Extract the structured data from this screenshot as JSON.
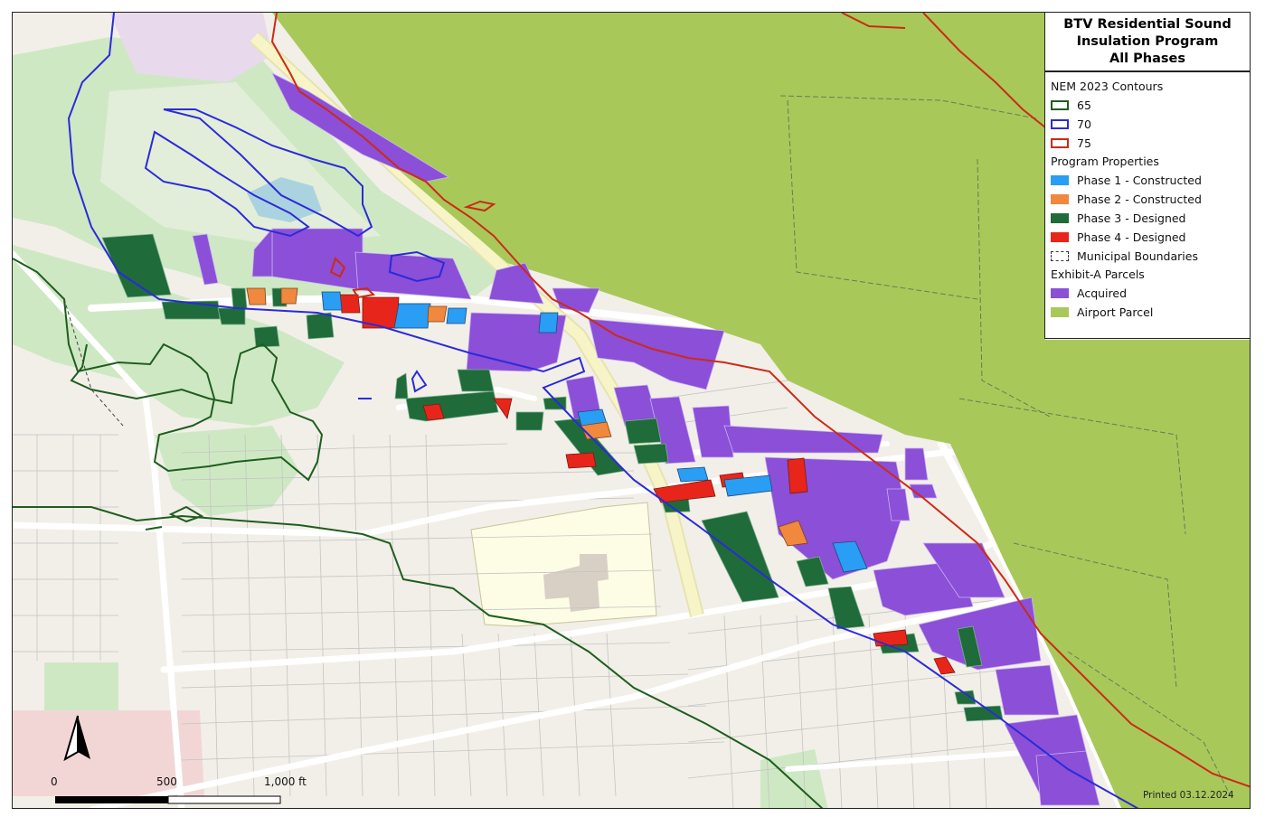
{
  "title": {
    "line1": "BTV Residential Sound",
    "line2": "Insulation Program",
    "line3": "All Phases"
  },
  "legend": {
    "contours_heading": "NEM 2023 Contours",
    "contours": [
      {
        "label": "65",
        "color": "#1e5e1e"
      },
      {
        "label": "70",
        "color": "#2b2bd9"
      },
      {
        "label": "75",
        "color": "#cc2a16"
      }
    ],
    "program_heading": "Program Properties",
    "program": [
      {
        "label": "Phase 1 - Constructed",
        "color": "#2a9df4"
      },
      {
        "label": "Phase 2 - Constructed",
        "color": "#f0883e"
      },
      {
        "label": "Phase 3 - Designed",
        "color": "#1f6b3a"
      },
      {
        "label": "Phase 4 - Designed",
        "color": "#e8251a"
      },
      {
        "label": "Municipal Boundaries",
        "color": "#333333"
      }
    ],
    "exhibit_heading": "Exhibit-A Parcels",
    "exhibit": [
      {
        "label": "Acquired",
        "color": "#8b4fd8"
      },
      {
        "label": "Airport Parcel",
        "color": "#a8c95a"
      }
    ]
  },
  "scale_bar": {
    "label_0": "0",
    "label_500": "500",
    "label_1000": "1,000 ft"
  },
  "printed": "Printed 03.12.2024",
  "colors": {
    "base": "#f2efe9",
    "park": "#cfe8c4",
    "school": "#fdfde6",
    "commercial": "#f2d6d6",
    "road": "#ffffff",
    "parcel_line": "#b8b8b8",
    "highway": "#f7f5c8",
    "water": "#aad3df"
  }
}
